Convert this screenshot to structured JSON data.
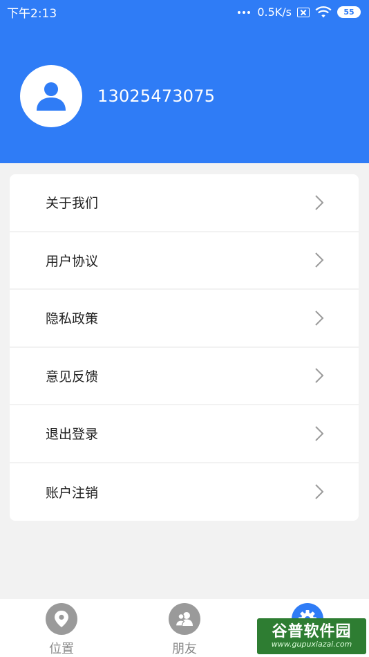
{
  "status_bar": {
    "time": "下午2:13",
    "network_speed": "0.5K/s",
    "battery": "55"
  },
  "profile": {
    "phone": "13025473075"
  },
  "menu": {
    "items": [
      {
        "label": "关于我们"
      },
      {
        "label": "用户协议"
      },
      {
        "label": "隐私政策"
      },
      {
        "label": "意见反馈"
      },
      {
        "label": "退出登录"
      },
      {
        "label": "账户注销"
      }
    ]
  },
  "bottom_nav": {
    "items": [
      {
        "label": "位置",
        "icon": "location-pin-icon"
      },
      {
        "label": "朋友",
        "icon": "friends-icon"
      },
      {
        "label": "",
        "icon": "settings-gear-icon",
        "active": true
      }
    ]
  },
  "watermark": {
    "title": "谷普软件园",
    "url": "www.gupuxiazai.com"
  },
  "colors": {
    "primary": "#2f7cf6",
    "inactive_icon": "#9a9a9a",
    "background": "#f2f2f2"
  }
}
